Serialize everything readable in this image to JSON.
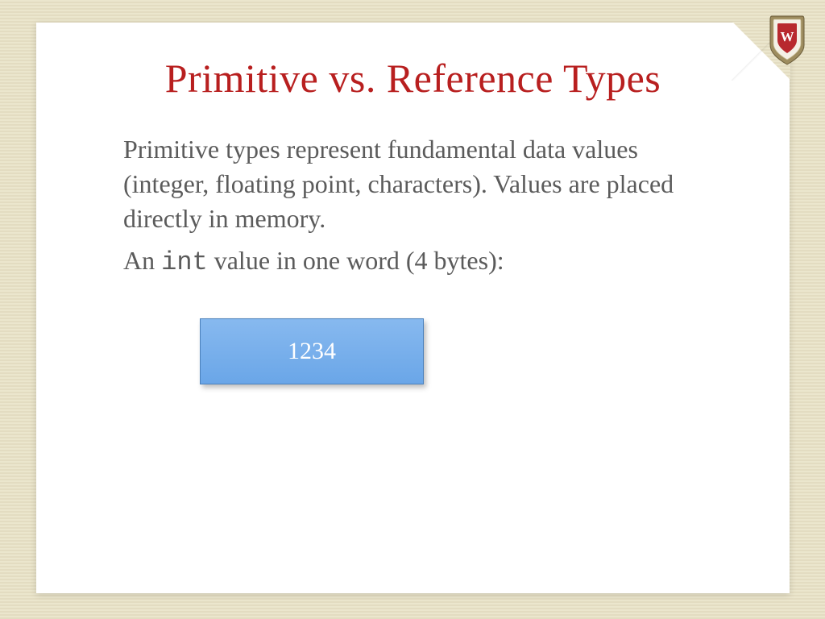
{
  "title": "Primitive vs. Reference Types",
  "paragraph1": "Primitive types represent fundamental data values (integer, floating point, characters). Values are placed directly in memory.",
  "line2_prefix": "An ",
  "line2_code": "int",
  "line2_suffix": " value in one word (4 bytes):",
  "box_value": "1234",
  "crest_letter": "W"
}
